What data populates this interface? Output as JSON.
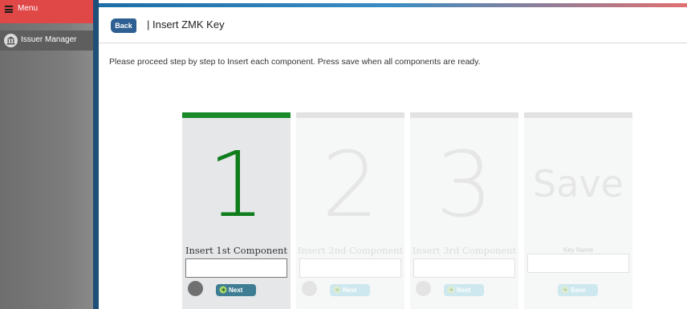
{
  "sidebar": {
    "menu_label": "Menu",
    "items": [
      {
        "label": "Issuer Manager",
        "icon": "bank-icon"
      }
    ]
  },
  "header": {
    "back_label": "Back",
    "title": "| Insert ZMK Key"
  },
  "instructions": "Please proceed step by step to Insert each component. Press save when all components are ready.",
  "steps": [
    {
      "number": "1",
      "label": "Insert 1st Component",
      "button": "Next",
      "state": "active"
    },
    {
      "number": "2",
      "label": "Insert 2nd Component",
      "button": "Next",
      "state": "disabled"
    },
    {
      "number": "3",
      "label": "Insert 3rd Component",
      "button": "Next",
      "state": "disabled"
    },
    {
      "number": "Save",
      "label": "Key Name",
      "button": "Save",
      "state": "disabled"
    }
  ],
  "colors": {
    "menu_red": "#e04848",
    "accent_blue": "#2e5f93",
    "active_green": "#0f7d1c",
    "button_teal": "#3e7d93"
  }
}
